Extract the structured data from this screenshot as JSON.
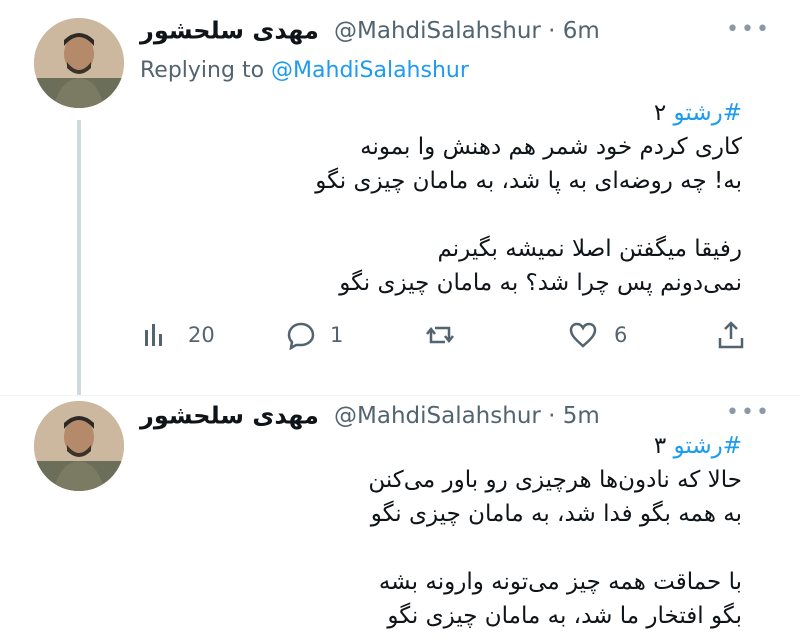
{
  "tweets": [
    {
      "author_name": "مهدی سلحشور",
      "handle": "@MahdiSalahshur",
      "separator": "·",
      "time": "6m",
      "replying_prefix": "Replying to",
      "replying_to": "@MahdiSalahshur",
      "hashtag": "#رشتو",
      "hashtag_suffix": " ۲",
      "lines": [
        "کاری کردم خود شمر هم دهنش وا بمونه",
        "به! چه روضه‌ای به پا شد، به مامان چیزی نگو",
        "",
        "رفیقا میگفتن اصلا نمیشه بگیرنم",
        "نمی‌دونم پس چرا شد؟ به مامان چیزی نگو"
      ],
      "stats": {
        "views": "20",
        "replies": "1",
        "retweets": "",
        "likes": "6"
      },
      "more_label": "•••"
    },
    {
      "author_name": "مهدی سلحشور",
      "handle": "@MahdiSalahshur",
      "separator": "·",
      "time": "5m",
      "hashtag": "#رشتو",
      "hashtag_suffix": " ۳",
      "lines": [
        "حالا که نادون‌ها هرچیزی رو باور می‌کنن",
        "به همه بگو فدا شد، به مامان چیزی نگو",
        "",
        "با حماقت همه چیز می‌تونه وارونه بشه",
        "بگو افتخار ما شد، به مامان چیزی نگو"
      ],
      "more_label": "•••"
    }
  ],
  "colors": {
    "link": "#1d9bf0",
    "muted": "#536471",
    "text": "#0f1419",
    "thread_line": "#cfd9de"
  },
  "icons": [
    "views-icon",
    "reply-icon",
    "retweet-icon",
    "like-icon",
    "share-icon",
    "more-icon"
  ]
}
